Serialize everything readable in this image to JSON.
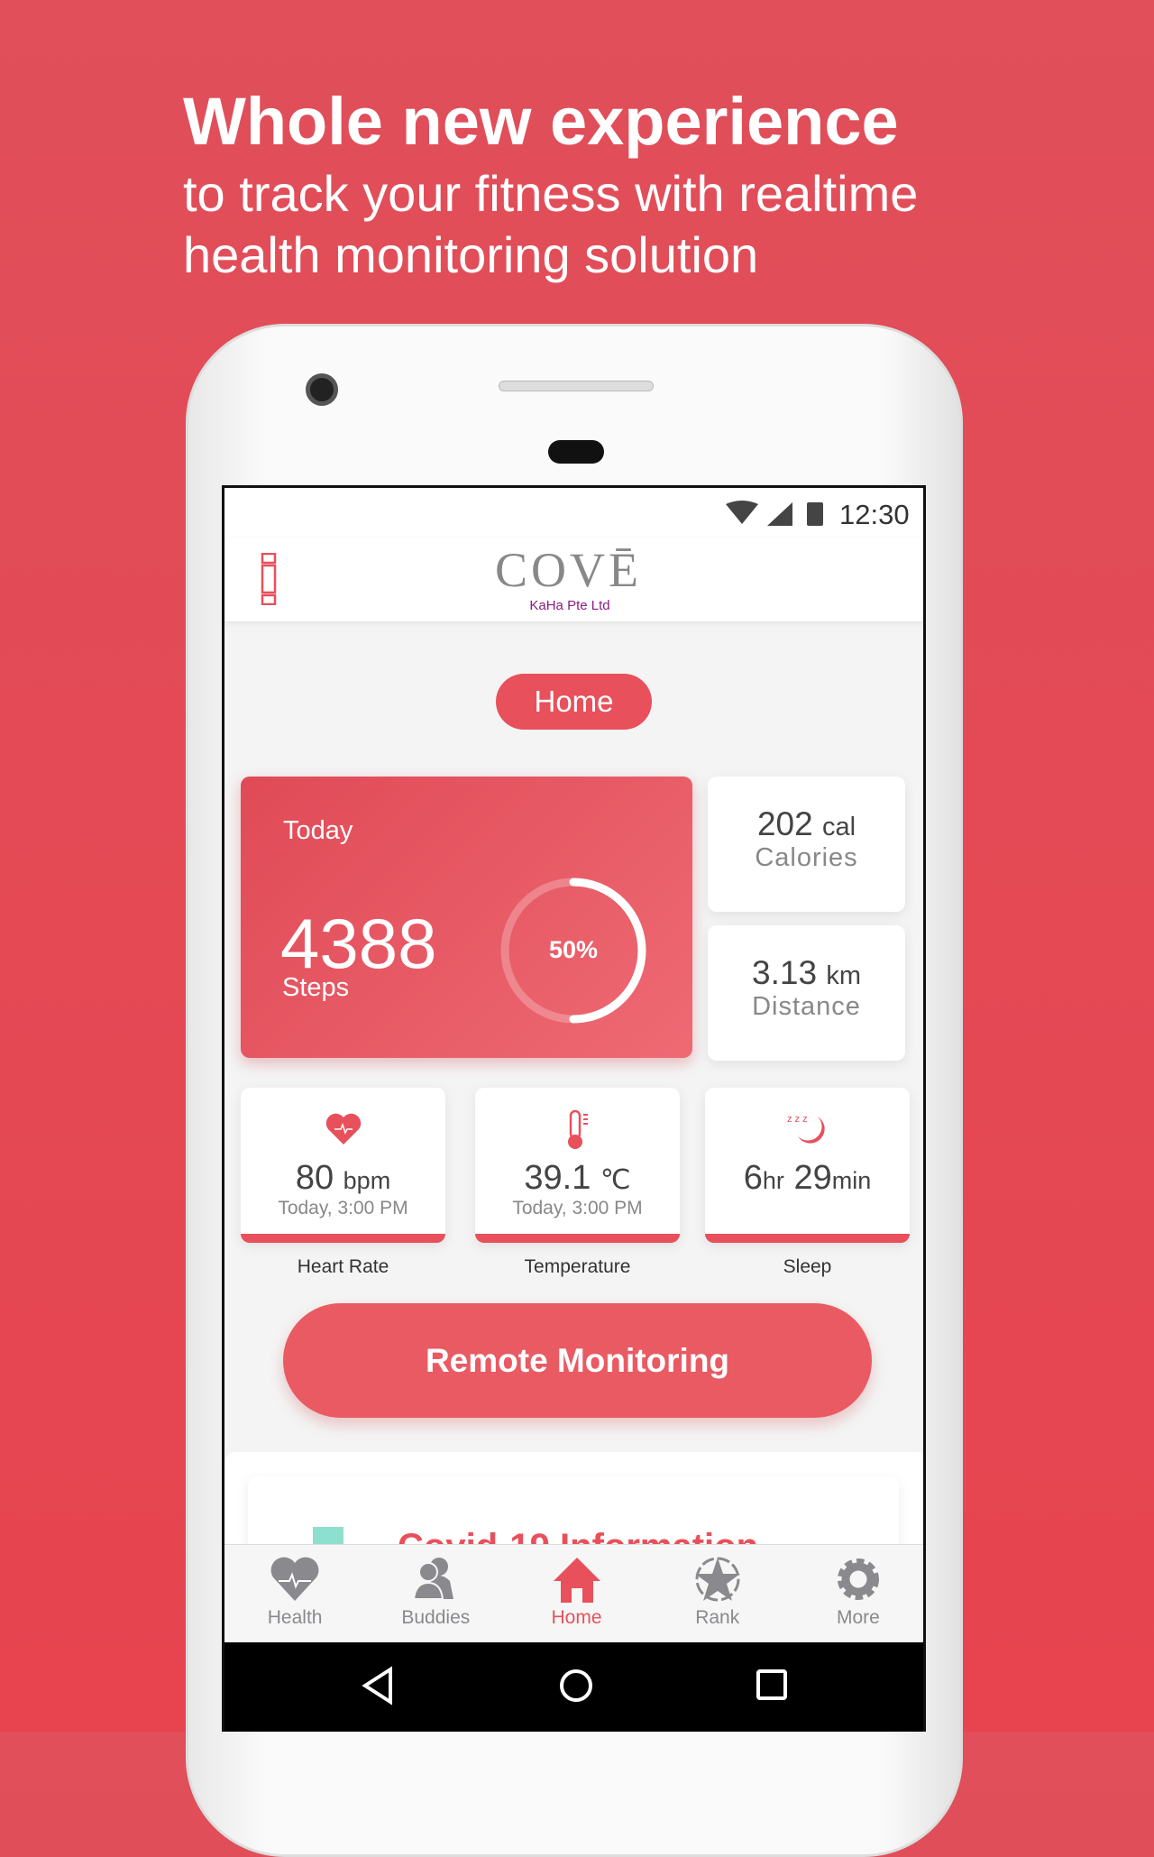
{
  "promo": {
    "title": "Whole new experience",
    "subtitle_line1": "to track your fitness with realtime",
    "subtitle_line2": "health monitoring solution"
  },
  "status_bar": {
    "time": "12:30"
  },
  "header": {
    "logo_text": "COVĒ",
    "logo_sub": "KaHa Pte Ltd"
  },
  "page_pill": "Home",
  "today": {
    "label": "Today",
    "steps": "4388",
    "steps_label": "Steps",
    "progress_text": "50%",
    "progress": 0.5
  },
  "calories": {
    "value": "202",
    "unit": "cal",
    "label": "Calories"
  },
  "distance": {
    "value": "3.13",
    "unit": "km",
    "label": "Distance"
  },
  "metrics": [
    {
      "value": "80",
      "unit": "bpm",
      "time": "Today, 3:00 PM",
      "label": "Heart Rate"
    },
    {
      "value": "39.1",
      "unit": "℃",
      "time": "Today, 3:00 PM",
      "label": "Temperature"
    },
    {
      "value": "6",
      "unit": "hr",
      "value2": "29",
      "unit2": "min",
      "label": "Sleep"
    }
  ],
  "remote_button": "Remote Monitoring",
  "covid_title": "Covid-19 Information",
  "nav": [
    {
      "label": "Health"
    },
    {
      "label": "Buddies"
    },
    {
      "label": "Home"
    },
    {
      "label": "Rank"
    },
    {
      "label": "More"
    }
  ],
  "colors": {
    "accent": "#e8505b",
    "inactive": "#8a8a8e",
    "teal": "#8de0cf"
  }
}
